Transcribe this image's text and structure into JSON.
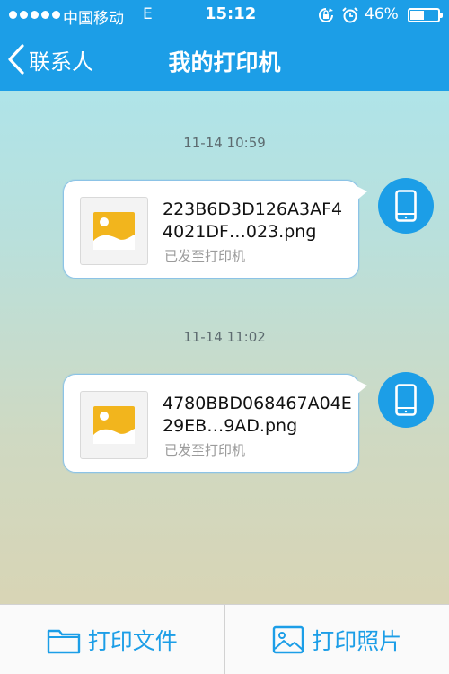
{
  "status_bar": {
    "carrier": "中国移动",
    "network": "E",
    "time": "15:12",
    "battery_percent": "46%",
    "battery_level": 0.46,
    "icons": [
      "rotation-lock-icon",
      "alarm-icon",
      "battery-icon"
    ]
  },
  "nav": {
    "back_label": "联系人",
    "title": "我的打印机"
  },
  "messages": [
    {
      "timestamp": "11-14 10:59",
      "filename": "223B6D3D126A3AF44021DF…023.png",
      "status": "已发至打印机"
    },
    {
      "timestamp": "11-14 11:02",
      "filename": "4780BBD068467A04E29EB…9AD.png",
      "status": "已发至打印机"
    }
  ],
  "toolbar": {
    "print_file_label": "打印文件",
    "print_photo_label": "打印照片"
  },
  "colors": {
    "accent": "#1c9ee7",
    "thumb_gold": "#f2b51d",
    "status_gray": "#9b9b9b"
  }
}
